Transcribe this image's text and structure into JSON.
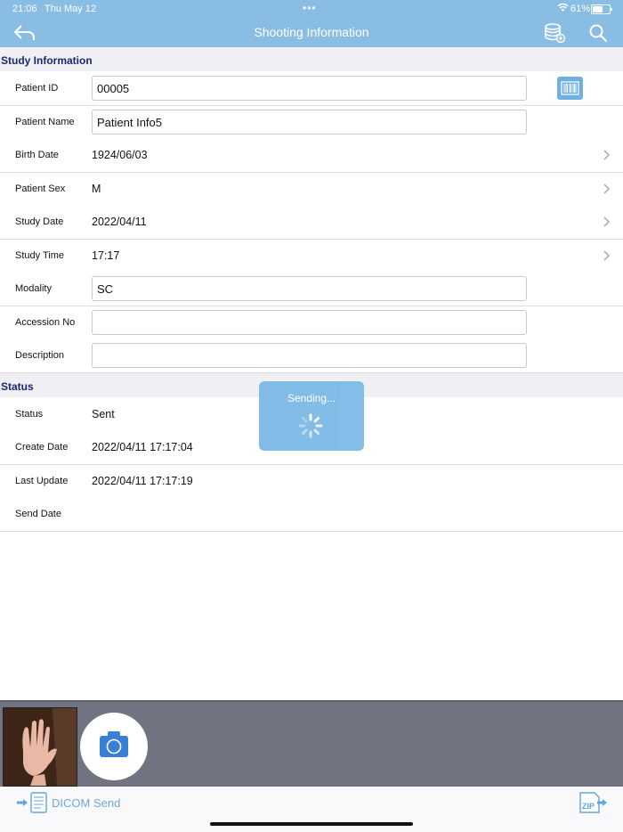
{
  "status_bar": {
    "time": "21:06",
    "date": "Thu May 12",
    "battery": "61%",
    "dots": "•••"
  },
  "nav": {
    "title": "Shooting Information"
  },
  "study_section": {
    "header": "Study Information",
    "rows": {
      "patient_id": {
        "label": "Patient ID",
        "value": "00005"
      },
      "patient_name": {
        "label": "Patient Name",
        "value": "Patient Info5"
      },
      "birth_date": {
        "label": "Birth Date",
        "value": "1924/06/03"
      },
      "patient_sex": {
        "label": "Patient Sex",
        "value": "M"
      },
      "study_date": {
        "label": "Study Date",
        "value": "2022/04/11"
      },
      "study_time": {
        "label": "Study Time",
        "value": "17:17"
      },
      "modality": {
        "label": "Modality",
        "value": "SC"
      },
      "accession_no": {
        "label": "Accession No",
        "value": ""
      },
      "description": {
        "label": "Description",
        "value": ""
      }
    }
  },
  "status_section": {
    "header": "Status",
    "rows": {
      "status": {
        "label": "Status",
        "value": "Sent"
      },
      "create_date": {
        "label": "Create Date",
        "value": "2022/04/11 17:17:04"
      },
      "last_update": {
        "label": "Last Update",
        "value": "2022/04/11 17:17:19"
      },
      "send_date": {
        "label": "Send Date",
        "value": ""
      }
    }
  },
  "overlay": {
    "sending_text": "Sending..."
  },
  "toolbar": {
    "dicom_send_label": "DICOM Send"
  },
  "colors": {
    "accent": "#89bde4",
    "section_text": "#1a2a6c",
    "button_blue": "#3a7fd6",
    "gallery_bg": "#717480"
  }
}
